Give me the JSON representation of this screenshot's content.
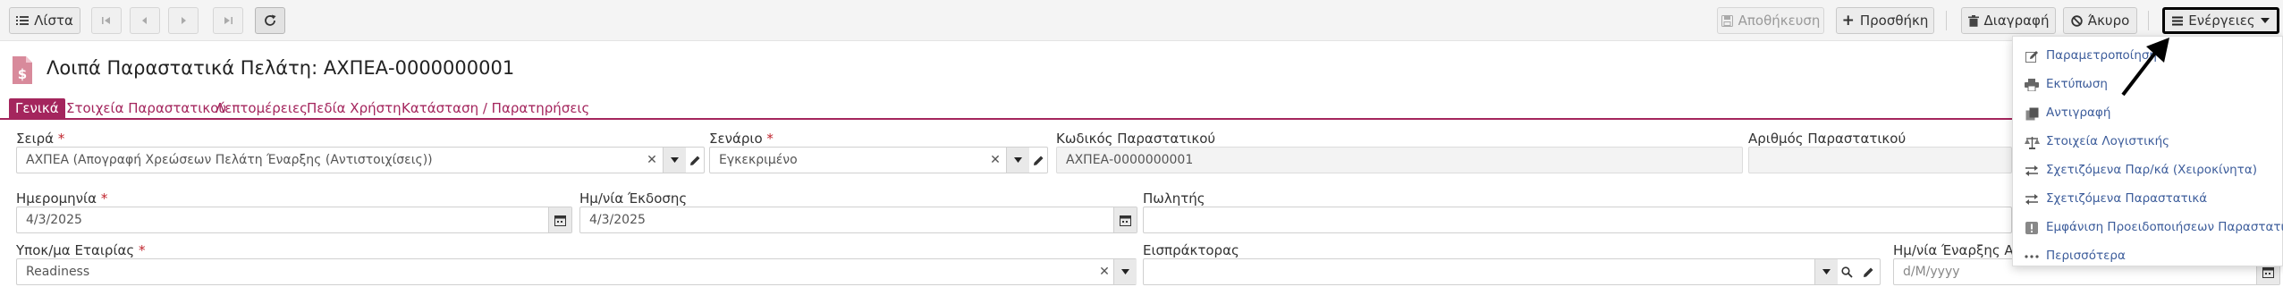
{
  "toolbar": {
    "list_label": "Λίστα",
    "save_label": "Αποθήκευση",
    "add_label": "Προσθήκη",
    "delete_label": "Διαγραφή",
    "cancel_label": "Άκυρο",
    "actions_label": "Ενέργειες"
  },
  "page": {
    "title": "Λοιπά Παραστατικά Πελάτη: ΑΧΠΕΑ-0000000001"
  },
  "tabs": [
    {
      "label": "Γενικά",
      "active": true
    },
    {
      "label": "Στοιχεία Παραστατικού"
    },
    {
      "label": "Λεπτομέρειες"
    },
    {
      "label": "Πεδία Χρήστη"
    },
    {
      "label": "Κατάσταση / Παρατηρήσεις"
    }
  ],
  "form": {
    "series": {
      "label": "Σειρά",
      "required_mark": "*",
      "value": "ΑΧΠΕΑ (Απογραφή Χρεώσεων Πελάτη Έναρξης (Αντιστοιχίσεις))"
    },
    "scenario": {
      "label": "Σενάριο",
      "required_mark": "*",
      "value": "Εγκεκριμένο"
    },
    "doc_code": {
      "label": "Κωδικός Παραστατικού",
      "value": "ΑΧΠΕΑ-0000000001"
    },
    "doc_number": {
      "label": "Αριθμός Παραστατικού",
      "value": ""
    },
    "date": {
      "label": "Ημερομηνία",
      "required_mark": "*",
      "value": "4/3/2025"
    },
    "issue_date": {
      "label": "Ημ/νία Έκδοσης",
      "value": "4/3/2025"
    },
    "salesman": {
      "label": "Πωλητής",
      "value": ""
    },
    "company_branch": {
      "label": "Υποκ/μα Εταιρίας",
      "required_mark": "*",
      "value": "Readiness"
    },
    "collector": {
      "label": "Εισπράκτορας",
      "value": ""
    },
    "start_date": {
      "label": "Ημ/νία Έναρξης Αντ",
      "placeholder": "d/M/yyyy"
    }
  },
  "actions_menu": [
    {
      "label": "Παραμετροποίηση",
      "icon": "pencil-icon"
    },
    {
      "label": "Εκτύπωση",
      "icon": "printer-icon"
    },
    {
      "label": "Αντιγραφή",
      "icon": "copy-icon"
    },
    {
      "label": "Στοιχεία Λογιστικής",
      "icon": "balance-icon"
    },
    {
      "label": "Σχετιζόμενα Παρ/κά (Χειροκίνητα)",
      "icon": "swap-icon"
    },
    {
      "label": "Σχετιζόμενα Παραστατικά",
      "icon": "swap-icon"
    },
    {
      "label": "Εμφάνιση Προειδοποιήσεων Παραστατικού",
      "icon": "warning-icon"
    },
    {
      "label": "Περισσότερα",
      "icon": "more-icon"
    }
  ],
  "colors": {
    "accent": "#a4255d",
    "link": "#3d5d9b",
    "required": "#c0242d"
  }
}
